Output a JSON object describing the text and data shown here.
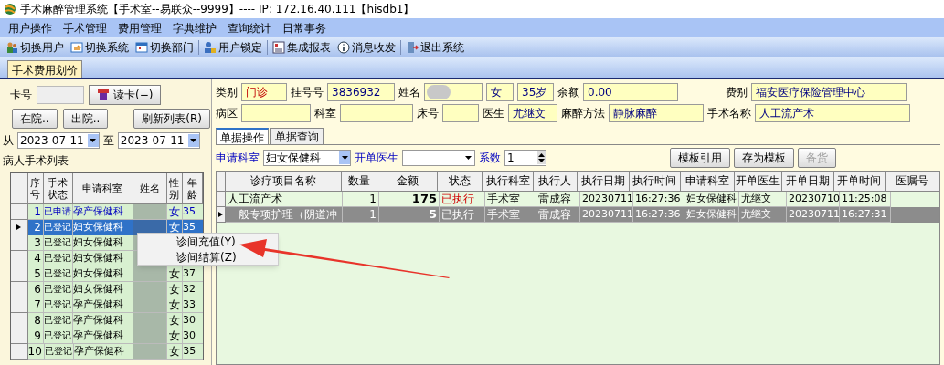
{
  "window": {
    "title": "手术麻醉管理系统【手术室--易联众--9999】---- IP: 172.16.40.111【hisdb1】"
  },
  "menu": [
    "用户操作",
    "手术管理",
    "费用管理",
    "字典维护",
    "查询统计",
    "日常事务"
  ],
  "toolbar": [
    {
      "label": "切换用户",
      "kind": "users"
    },
    {
      "label": "切换系统",
      "kind": "switch"
    },
    {
      "label": "切换部门",
      "kind": "dept"
    },
    {
      "label": "用户锁定",
      "kind": "lock"
    },
    {
      "label": "集成报表",
      "kind": "report"
    },
    {
      "label": "消息收发",
      "kind": "info"
    },
    {
      "label": "退出系统",
      "kind": "exit"
    }
  ],
  "doc_tab": {
    "label": "手术费用划价",
    "selected": true
  },
  "left": {
    "card_label": "卡号",
    "read_card": "读卡(−)",
    "in_hospital": "在院..",
    "discharged": "出院..",
    "refresh": "刷新列表(R)",
    "from_label": "从",
    "from_date": "2023-07-11",
    "to_label": "至",
    "to_date": "2023-07-11",
    "list_title": "病人手术列表",
    "columns": [
      "序号",
      "手术状态",
      "申请科室",
      "姓名",
      "性别",
      "年龄"
    ],
    "rows": [
      {
        "no": "1",
        "status": "已申请",
        "dept": "孕产保健科",
        "gender": "女",
        "age": "35",
        "applied": true,
        "selected": false
      },
      {
        "no": "2",
        "status": "已登记",
        "dept": "妇女保健科",
        "gender": "女",
        "age": "35",
        "applied": false,
        "selected": true
      },
      {
        "no": "3",
        "status": "已登记",
        "dept": "妇女保健科",
        "applied": false,
        "selected": false
      },
      {
        "no": "4",
        "status": "已登记",
        "dept": "妇女保健科",
        "applied": false,
        "selected": false
      },
      {
        "no": "5",
        "status": "已登记",
        "dept": "妇女保健科",
        "gender": "女",
        "age": "37",
        "applied": false,
        "selected": false
      },
      {
        "no": "6",
        "status": "已登记",
        "dept": "妇女保健科",
        "gender": "女",
        "age": "32",
        "applied": false,
        "selected": false
      },
      {
        "no": "7",
        "status": "已登记",
        "dept": "孕产保健科",
        "gender": "女",
        "age": "33",
        "applied": false,
        "selected": false
      },
      {
        "no": "8",
        "status": "已登记",
        "dept": "孕产保健科",
        "gender": "女",
        "age": "30",
        "applied": false,
        "selected": false
      },
      {
        "no": "9",
        "status": "已登记",
        "dept": "孕产保健科",
        "gender": "女",
        "age": "30",
        "applied": false,
        "selected": false
      },
      {
        "no": "10",
        "status": "已登记",
        "dept": "孕产保健科",
        "gender": "女",
        "age": "35",
        "applied": false,
        "selected": false
      }
    ]
  },
  "context_menu": [
    "诊间充值(Y)",
    "诊间结算(Z)"
  ],
  "patient": {
    "category_label": "类别",
    "category": "门诊",
    "reg_label": "挂号号",
    "reg_no": "3836932",
    "name_label": "姓名",
    "gender": "女",
    "age": "35岁",
    "balance_label": "余额",
    "balance": "0.00",
    "fee_label": "费别",
    "fee_type": "福安医疗保险管理中心",
    "ward_label": "病区",
    "dept_label": "科室",
    "bed_label": "床号",
    "doctor_label": "医生",
    "doctor": "尤继文",
    "anes_label": "麻醉方法",
    "anes": "静脉麻醉",
    "op_label": "手术名称",
    "op": "人工流产术"
  },
  "sub_tabs": [
    {
      "label": "单据操作",
      "selected": true
    },
    {
      "label": "单据查询",
      "selected": false
    }
  ],
  "filter": {
    "dept_label": "申请科室",
    "dept": "妇女保健科",
    "doctor_label": "开单医生",
    "coef_label": "系数",
    "coef": "1",
    "template_use": "模板引用",
    "template_save": "存为模板",
    "stock": "备货",
    "stock_disabled": true
  },
  "bill": {
    "columns": [
      "诊疗项目名称",
      "数量",
      "金额",
      "状态",
      "执行科室",
      "执行人",
      "执行日期",
      "执行时间",
      "申请科室",
      "开单医生",
      "开单日期",
      "开单时间",
      "医嘱号"
    ],
    "rows": [
      {
        "cells": [
          "人工流产术",
          "1",
          "175",
          "已执行",
          "手术室",
          "雷成容",
          "20230711",
          "16:27:36",
          "妇女保健科",
          "尤继文",
          "20230710",
          "11:25:08"
        ],
        "selected": false
      },
      {
        "cells": [
          "一般专项护理（阴道冲",
          "1",
          "5",
          "已执行",
          "手术室",
          "雷成容",
          "20230711",
          "16:27:36",
          "妇女保健科",
          "尤继文",
          "20230711",
          "16:27:31"
        ],
        "selected": true
      }
    ]
  }
}
